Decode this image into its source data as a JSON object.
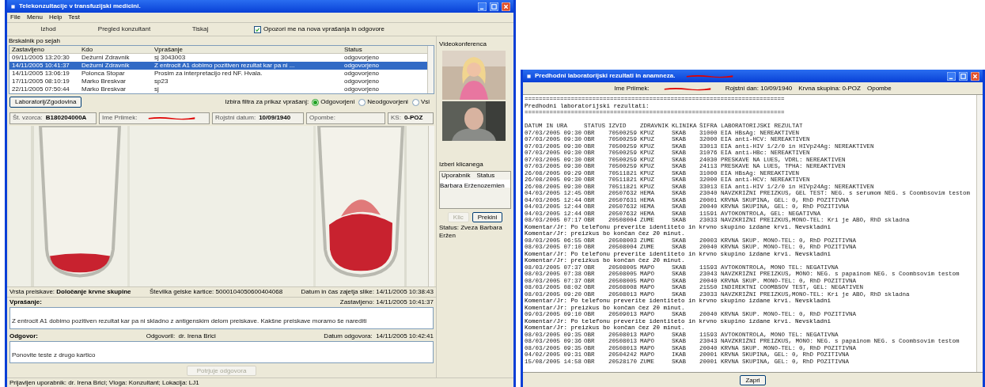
{
  "main_window": {
    "title": "Telekonzultacije v transfuzijski medicini.",
    "menu": [
      "File",
      "Menu",
      "Help",
      "Test"
    ],
    "toolbar": {
      "buttons": [
        "Izhod",
        "Pregled konzultant",
        "Tiskaj"
      ],
      "notify": {
        "label": "Opozori me na nova vprašanja in odgovore",
        "checked": true
      }
    },
    "sessions": {
      "label": "Brskalnik po sejah",
      "columns": [
        "Zastavljeno",
        "Kdo",
        "Vprašanje",
        "Status"
      ],
      "rows": [
        {
          "cells": [
            "09/11/2005 13:20:30",
            "Dežurni Zdravnik",
            "sj 3043003",
            "odgovorjeno"
          ],
          "selected": false
        },
        {
          "cells": [
            "14/11/2005 10:41:37",
            "Dežurni Zdravnik",
            "Z entrocit A1 dobimo pozitiven rezultat kar pa ni ...",
            "odgovorjeno"
          ],
          "selected": true
        },
        {
          "cells": [
            "14/11/2005 13:06:19",
            "Polonca Stopar",
            "Prosim za interpretacijo red NF. Hvala.",
            "odgovorjeno"
          ],
          "selected": false
        },
        {
          "cells": [
            "17/11/2005 08:10:19",
            "Marko Breskvar",
            "sp23",
            "odgovorjeno"
          ],
          "selected": false
        },
        {
          "cells": [
            "22/11/2005 07:50:44",
            "Marko Breskvar",
            "sj",
            "odgovorjeno"
          ],
          "selected": false
        }
      ]
    },
    "lab_button": "Laboratorij/Zgodovina",
    "filter": {
      "label": "Izbira filtra za prikaz vprašanj:",
      "options": [
        {
          "label": "Odgovorjeni",
          "selected": true
        },
        {
          "label": "Neodgovorjeni",
          "selected": false
        },
        {
          "label": "Vsi",
          "selected": false
        }
      ]
    },
    "sample": [
      {
        "label": "Št. vzorca:",
        "value": "B180204000A",
        "redacted": false
      },
      {
        "label": "Ime Priimek:",
        "redacted": true
      },
      {
        "label": "Rojstni datum:",
        "value": "10/09/1940",
        "redacted": false
      },
      {
        "label": "Opombe:",
        "redacted": false
      },
      {
        "label": "KS:",
        "value": "0-POZ",
        "redacted": false
      }
    ],
    "image": {
      "kind": "picture"
    },
    "caption": [
      "Vrsta preiskave: **Določanje krvne skupine**",
      "Številka gelske kartice: 5000104050600404068",
      "Datum in čas zajetja slike: 14/11/2005 10:38:43"
    ],
    "question": {
      "label": "Vprašanje:",
      "meta": [
        "Zastavljeno: 14/11/2005 10:41:37"
      ],
      "text": "Z entrocit A1 dobimo pozitiven rezultat kar pa ni skladno z antigenskim delom preiskave. Kakšne preiskave moramo še narediti"
    },
    "answer": {
      "label": "Odgovor:",
      "meta": [
        "Odgovoril:  dr. Irena Brici",
        "Datum odgovora:  14/11/2005 10:42:41"
      ],
      "text": "Ponovite teste z drugo kartico"
    },
    "confirm_button": {
      "label": "Potrjuje odgovora",
      "disabled": true
    },
    "status_bar": "Prijavljen uporabnik: dr. Irena Brici; Vloga: Konzultant; Lokacija: LJ1"
  },
  "video": {
    "title": "Videokonferenca",
    "callee_label": "Izberi klicanega",
    "columns": [
      "Uporabnik",
      "Status"
    ],
    "rows": [
      {
        "text": "Barbara Erženozemlen",
        "selected": true
      }
    ],
    "buttons": [
      {
        "label": "Klic",
        "disabled": true
      },
      {
        "label": "Prekini",
        "disabled": false
      }
    ],
    "status": "Status: Zveza Barbara Eržen"
  },
  "lab_window": {
    "title": "Predhodni laboratorijski rezultati in anamneza.",
    "title_redacted": true,
    "info": [
      {
        "label": "Ime Priimek:",
        "redacted": true
      },
      {
        "label": "Rojstni dan: 10/09/1940",
        "redacted": false
      },
      {
        "label": "Krvna skupina: 0-POZ",
        "redacted": false
      },
      {
        "label": "Opombe",
        "redacted": false
      }
    ],
    "lines": [
      {
        "kind": "text",
        "text": "========================================================================="
      },
      {
        "kind": "text",
        "text": "Predhodni laboratorijski rezultati:"
      },
      {
        "kind": "text",
        "text": "========================================================================="
      },
      {
        "kind": "blank"
      },
      {
        "kind": "row",
        "cells": [
          "DATUM IN URA",
          "STATUS",
          "IZVID",
          "ZDRAVNIK",
          "KLINIKA",
          "ŠIFRA",
          "LABORATORIJSKI REZULTAT"
        ]
      },
      {
        "kind": "row",
        "cells": [
          "07/03/2005 09:30",
          "OBR",
          "70500259",
          "KPUZ",
          "SKAB",
          "31000",
          "EIA HBsAg: NEREAKTIVEN"
        ]
      },
      {
        "kind": "row",
        "cells": [
          "07/03/2005 09:30",
          "OBR",
          "70500259",
          "KPUZ",
          "SKAB",
          "32000",
          "EIA anti-HCV: NEREAKTIVEN"
        ]
      },
      {
        "kind": "row",
        "cells": [
          "07/03/2005 09:30",
          "OBR",
          "70500259",
          "KPUZ",
          "SKAB",
          "33013",
          "EIA anti-HIV 1/2/0 in HIVp24Ag: NEREAKTIVEN"
        ]
      },
      {
        "kind": "row",
        "cells": [
          "07/03/2005 09:30",
          "OBR",
          "70500259",
          "KPUZ",
          "SKAB",
          "31076",
          "EIA anti-HBc: NEREAKTIVEN"
        ]
      },
      {
        "kind": "row",
        "cells": [
          "07/03/2005 09:30",
          "OBR",
          "70500259",
          "KPUZ",
          "SKAB",
          "24030",
          "PRESKAVE NA LUES, VDRL: NEREAKTIVEN"
        ]
      },
      {
        "kind": "row",
        "cells": [
          "07/03/2005 09:30",
          "OBR",
          "70500259",
          "KPUZ",
          "SKAB",
          "24113",
          "PRESKAVE NA LUES, TPHA: NEREAKTIVEN"
        ]
      },
      {
        "kind": "row",
        "cells": [
          "26/08/2005 09:29",
          "OBR",
          "70511821",
          "KPUZ",
          "SKAB",
          "31000",
          "EIA HBsAg: NEREAKTIVEN"
        ]
      },
      {
        "kind": "row",
        "cells": [
          "26/08/2005 09:30",
          "OBR",
          "70511821",
          "KPUZ",
          "SKAB",
          "32000",
          "EIA anti-HCV: NEREAKTIVEN"
        ]
      },
      {
        "kind": "row",
        "cells": [
          "26/08/2005 09:30",
          "OBR",
          "70511821",
          "KPUZ",
          "SKAB",
          "33013",
          "EIA anti-HIV 1/2/0 in HIVp24Ag: NEREAKTIVEN"
        ]
      },
      {
        "kind": "row",
        "cells": [
          "04/03/2005 12:45",
          "OBR",
          "20507632",
          "HEMA",
          "SKAB",
          "23040",
          "NAVZKRIŽNI PREIZKUS, GEL TEST: NEG. s serumom NEG. s Coombsovim testom"
        ]
      },
      {
        "kind": "row",
        "cells": [
          "04/03/2005 12:44",
          "OBR",
          "20507631",
          "HEMA",
          "SKAB",
          "20001",
          "KRVNA SKUPINA, GEL: 0, RhD POZITIVNA"
        ]
      },
      {
        "kind": "row",
        "cells": [
          "04/03/2005 12:44",
          "OBR",
          "20507632",
          "HEMA",
          "SKAB",
          "20040",
          "KRVNA SKUPINA, GEL: 0, RhD POZITIVNA"
        ]
      },
      {
        "kind": "row",
        "cells": [
          "04/03/2005 12:44",
          "OBR",
          "20507632",
          "HEMA",
          "SKAB",
          "11591",
          "AVTOKONTROLA, GEL: NEGATIVNA"
        ]
      },
      {
        "kind": "row",
        "cells": [
          "08/03/2005 07:17",
          "OBR",
          "20508004",
          "ZUME",
          "SKAB",
          "23033",
          "NAVZKRIŽNI PREIZKUS,MONO-TEL: Kri je ABO, RhD skladna"
        ]
      },
      {
        "kind": "text",
        "text": "Komentar/Jr: Po telefonu preverite identiteto in krvno skupino izdane krvi. Nevskladni"
      },
      {
        "kind": "text",
        "text": "Komentar/Jr: preizkus bo končan čez 20 minut."
      },
      {
        "kind": "row",
        "cells": [
          "08/03/2005 06:55",
          "OBR",
          "20508003",
          "ZUME",
          "SKAB",
          "20003",
          "KRVNA SKUP. MONO-TEL: 0, RhD POZITIVNA"
        ]
      },
      {
        "kind": "row",
        "cells": [
          "08/03/2005 07:10",
          "OBR",
          "20508004",
          "ZUME",
          "SKAB",
          "20040",
          "KRVNA SKUP. MONO-TEL: 0, RhD POZITIVNA"
        ]
      },
      {
        "kind": "text",
        "text": "Komentar/Jr: Po telefonu preverite identiteto in krvno skupino izdane krvi. Nevskladni"
      },
      {
        "kind": "text",
        "text": "Komentar/Jr: preizkus bo končan čez 20 minut."
      },
      {
        "kind": "row",
        "cells": [
          "08/03/2005 07:37",
          "OBR",
          "20508005",
          "MAPO",
          "SKAB",
          "11593",
          "AVTOKONTROLA, MONO TEL: NEGATIVNA"
        ]
      },
      {
        "kind": "row",
        "cells": [
          "08/03/2005 07:38",
          "OBR",
          "20508005",
          "MAPO",
          "SKAB",
          "23043",
          "NAVZKRIŽNI PREIZKUS, MONO: NEG. s papainom NEG. s Coombsovim testom"
        ]
      },
      {
        "kind": "row",
        "cells": [
          "08/03/2005 07:37",
          "OBR",
          "20508005",
          "MAPO",
          "SKAB",
          "20040",
          "KRVNA SKUP. MONO-TEL: 0, RhD POZITIVNA"
        ]
      },
      {
        "kind": "row",
        "cells": [
          "08/03/2005 08:02",
          "OBR",
          "20508008",
          "MAPO",
          "SKAB",
          "21550",
          "INDIREKTNI COOMBSOV TEST, GEL: NEGATIVEN"
        ]
      },
      {
        "kind": "row",
        "cells": [
          "08/03/2005 09:20",
          "OBR",
          "20508013",
          "MAPO",
          "SKAB",
          "23033",
          "NAVZKRIŽNI PREIZKUS,MONO-TEL: Kri je ABO, RhD skladna"
        ]
      },
      {
        "kind": "text",
        "text": "Komentar/Jr: Po telefonu preverite identiteto in krvno skupino izdane krvi. Nevskladni"
      },
      {
        "kind": "text",
        "text": "Komentar/Jr: preizkus bo končan čez 20 minut."
      },
      {
        "kind": "row",
        "cells": [
          "09/03/2005 09:10",
          "OBR",
          "20509013",
          "MAPO",
          "SKAB",
          "20040",
          "KRVNA SKUP. MONO-TEL: 0, RhD POZITIVNA"
        ]
      },
      {
        "kind": "text",
        "text": "Komentar/Jr: Po telefonu preverite identiteto in krvno skupino izdane krvi. Nevskladni"
      },
      {
        "kind": "text",
        "text": "Komentar/Jr: preizkus bo končan čez 20 minut."
      },
      {
        "kind": "row",
        "cells": [
          "08/03/2005 09:35",
          "OBR",
          "20508013",
          "MAPO",
          "SKAB",
          "11593",
          "AVTOKONTROLA, MONO TEL: NEGATIVNA"
        ]
      },
      {
        "kind": "row",
        "cells": [
          "08/03/2005 09:36",
          "OBR",
          "20508013",
          "MAPO",
          "SKAB",
          "23043",
          "NAVZKRIŽNI PREIZKUS, MONO: NEG. s papainom NEG. s Coombsovim testom"
        ]
      },
      {
        "kind": "row",
        "cells": [
          "08/03/2005 09:35",
          "OBR",
          "20508013",
          "MAPO",
          "SKAB",
          "20040",
          "KRVNA SKUP. MONO-TEL: 0, RhD POZITIVNA"
        ]
      },
      {
        "kind": "row",
        "cells": [
          "04/02/2005 09:31",
          "OBR",
          "20504242",
          "MAPO",
          "IKAB",
          "20001",
          "KRVNA SKUPINA, GEL: 0, RhD POZITIVNA"
        ]
      },
      {
        "kind": "row",
        "cells": [
          "15/08/2005 14:58",
          "OBR",
          "20528170",
          "ZUME",
          "SKAB",
          "20001",
          "KRVNA SKUPINA, GEL: 0, RhD POZITIVNA"
        ]
      }
    ],
    "close_button": "Zapri"
  }
}
